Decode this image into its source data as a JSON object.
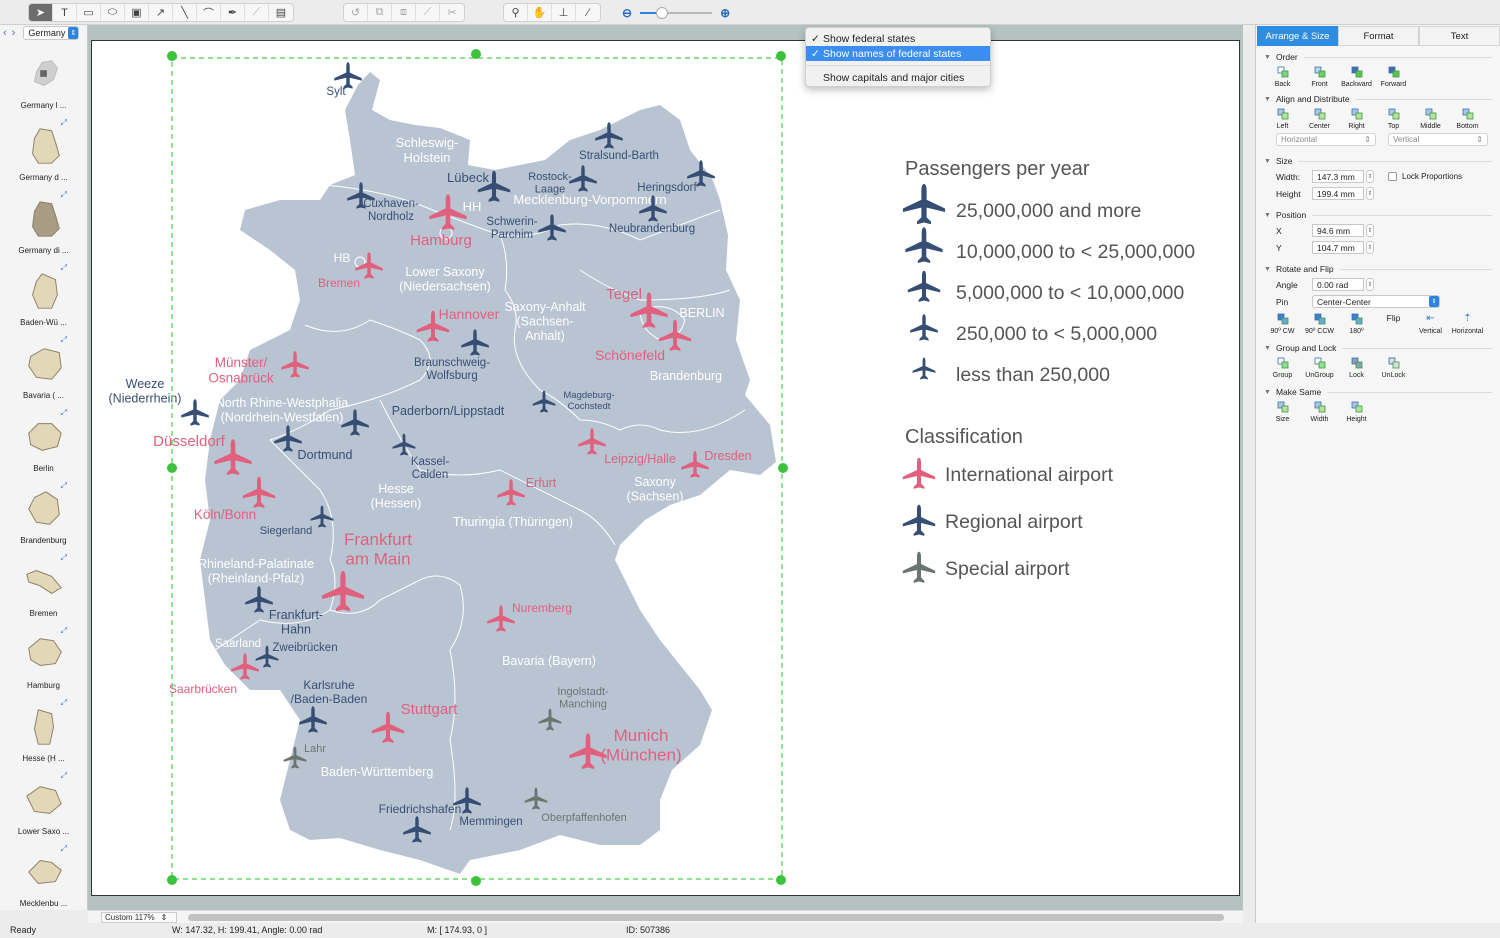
{
  "toolbar": {
    "groups": [
      {
        "icons": [
          "pointer-tool",
          "text-tool",
          "rectangle-tool",
          "ellipse-tool",
          "container-tool",
          "arrow-tool",
          "line-tool",
          "arc-tool",
          "pen-tool",
          "bezier-tool",
          "note-tool"
        ]
      },
      {
        "icons": [
          "rotate",
          "group-align",
          "ungroup-align",
          "connect",
          "disconnect"
        ]
      },
      {
        "icons": [
          "zoom-tool",
          "hand-tool",
          "stamp-tool",
          "eyedropper-tool"
        ]
      }
    ],
    "zoom_slider_percent": 30
  },
  "library": {
    "selected": "Germany",
    "items": [
      {
        "label": "Germany l ..."
      },
      {
        "label": "Germany d ..."
      },
      {
        "label": "Germany di ..."
      },
      {
        "label": "Baden-Wü ..."
      },
      {
        "label": "Bavaria ( ..."
      },
      {
        "label": "Berlin"
      },
      {
        "label": "Brandenburg"
      },
      {
        "label": "Bremen"
      },
      {
        "label": "Hamburg"
      },
      {
        "label": "Hesse (H ..."
      },
      {
        "label": "Lower Saxo ..."
      },
      {
        "label": "Mecklenbu ..."
      }
    ]
  },
  "context_menu": {
    "items": [
      {
        "label": "Show federal states",
        "checked": true,
        "highlighted": false
      },
      {
        "label": "Show names of federal states",
        "checked": true,
        "highlighted": true
      },
      {
        "label": "Show capitals and major cities",
        "checked": false,
        "highlighted": false
      }
    ]
  },
  "map": {
    "colors": {
      "land": "#b9c4d2",
      "international": "#e0607e",
      "regional": "#374e74",
      "special": "#6a7570",
      "state_label": "#ffffff"
    },
    "states": [
      {
        "name": "Schleswig-\nHolstein"
      },
      {
        "name": "HH"
      },
      {
        "name": "Mecklenburg-Vorpommern"
      },
      {
        "name": "HB"
      },
      {
        "name": "Lower Saxony\n(Niedersachsen)"
      },
      {
        "name": "Saxony-Anhalt\n(Sachsen-\nAnhalt)"
      },
      {
        "name": "BERLIN"
      },
      {
        "name": "Brandenburg"
      },
      {
        "name": "North Rhine-Westphalia\n(Nordrhein-Westfalen)"
      },
      {
        "name": "Hesse\n(Hessen)"
      },
      {
        "name": "Thuringia (Thüringen)"
      },
      {
        "name": "Saxony\n(Sachsen)"
      },
      {
        "name": "Rhineland-Palatinate\n(Rheinland-Pfalz)"
      },
      {
        "name": "Saarland"
      },
      {
        "name": "Bavaria (Bayern)"
      },
      {
        "name": "Baden-Württemberg"
      }
    ],
    "airports": [
      {
        "name": "Sylt",
        "class": "regional",
        "size": 4
      },
      {
        "name": "Lübeck",
        "class": "regional",
        "size": 3
      },
      {
        "name": "Cuxhaven-\nNordholz",
        "class": "regional",
        "size": 4
      },
      {
        "name": "Hamburg",
        "class": "international",
        "size": 2
      },
      {
        "name": "Rostock-\nLaage",
        "class": "regional",
        "size": 4
      },
      {
        "name": "Stralsund-Barth",
        "class": "regional",
        "size": 4
      },
      {
        "name": "Heringsdorf",
        "class": "regional",
        "size": 4
      },
      {
        "name": "Schwerin-\nParchim",
        "class": "regional",
        "size": 4
      },
      {
        "name": "Neubrandenburg",
        "class": "regional",
        "size": 4
      },
      {
        "name": "Bremen",
        "class": "international",
        "size": 4
      },
      {
        "name": "Hannover",
        "class": "international",
        "size": 3
      },
      {
        "name": "Braunschweig-\nWolfsburg",
        "class": "regional",
        "size": 4
      },
      {
        "name": "Tegel",
        "class": "international",
        "size": 2
      },
      {
        "name": "Schönefeld",
        "class": "international",
        "size": 3
      },
      {
        "name": "Münster/\nOsnabrück",
        "class": "international",
        "size": 4
      },
      {
        "name": "Weeze\n(Niederrhein)",
        "class": "regional",
        "size": 4
      },
      {
        "name": "Paderborn/Lippstadt",
        "class": "regional",
        "size": 4
      },
      {
        "name": "Dortmund",
        "class": "regional",
        "size": 4
      },
      {
        "name": "Magdeburg-\nCochstedt",
        "class": "regional",
        "size": 5
      },
      {
        "name": "Düsseldorf",
        "class": "international",
        "size": 2
      },
      {
        "name": "Kassel-\nCalden",
        "class": "regional",
        "size": 5
      },
      {
        "name": "Leipzig/Halle",
        "class": "international",
        "size": 4
      },
      {
        "name": "Dresden",
        "class": "international",
        "size": 4
      },
      {
        "name": "Erfurt",
        "class": "international",
        "size": 4
      },
      {
        "name": "Köln/Bonn",
        "class": "international",
        "size": 3
      },
      {
        "name": "Siegerland",
        "class": "regional",
        "size": 5
      },
      {
        "name": "Frankfurt\nam Main",
        "class": "international",
        "size": 1
      },
      {
        "name": "Frankfurt-\nHahn",
        "class": "regional",
        "size": 4
      },
      {
        "name": "Nuremberg",
        "class": "international",
        "size": 4
      },
      {
        "name": "Saarbrücken",
        "class": "international",
        "size": 4
      },
      {
        "name": "Zweibrücken",
        "class": "regional",
        "size": 5
      },
      {
        "name": "Karlsruhe\n/Baden-Baden",
        "class": "regional",
        "size": 4
      },
      {
        "name": "Stuttgart",
        "class": "international",
        "size": 3
      },
      {
        "name": "Ingolstadt-\nManching",
        "class": "special",
        "size": 5
      },
      {
        "name": "Munich\n(München)",
        "class": "international",
        "size": 2
      },
      {
        "name": "Lahr",
        "class": "special",
        "size": 5
      },
      {
        "name": "Friedrichshafen",
        "class": "regional",
        "size": 4
      },
      {
        "name": "Memmingen",
        "class": "regional",
        "size": 4
      },
      {
        "name": "Oberpfaffenhofen",
        "class": "special",
        "size": 5
      }
    ]
  },
  "legend": {
    "passengers_title": "Passengers per year",
    "passengers": [
      {
        "label": "25,000,000 and more"
      },
      {
        "label": "10,000,000 to < 25,000,000"
      },
      {
        "label": "5,000,000 to < 10,000,000"
      },
      {
        "label": "250,000 to < 5,000,000"
      },
      {
        "label": "less than 250,000"
      }
    ],
    "classification_title": "Classification",
    "classification": [
      {
        "label": "International airport",
        "color": "#e0607e"
      },
      {
        "label": "Regional airport",
        "color": "#374e74"
      },
      {
        "label": "Special airport",
        "color": "#6a7570"
      }
    ]
  },
  "canvas": {
    "zoom_label": "Custom 117%"
  },
  "status": {
    "ready": "Ready",
    "dims": "W: 147.32,  H: 199.41,  Angle: 0.00 rad",
    "mouse": "M: [ 174.93, 0 ]",
    "id": "ID: 507386"
  },
  "inspector": {
    "tabs": [
      "Arrange & Size",
      "Format",
      "Text"
    ],
    "order": {
      "title": "Order",
      "buttons": [
        "Back",
        "Front",
        "Backward",
        "Forward"
      ]
    },
    "align": {
      "title": "Align and Distribute",
      "buttons": [
        "Left",
        "Center",
        "Right",
        "Top",
        "Middle",
        "Bottom"
      ],
      "horizontal": "Horizontal",
      "vertical": "Vertical"
    },
    "size": {
      "title": "Size",
      "width_label": "Width:",
      "width": "147.3 mm",
      "height_label": "Height",
      "height": "199.4 mm",
      "lock": "Lock Proportions"
    },
    "position": {
      "title": "Position",
      "x_label": "X",
      "x": "94.6 mm",
      "y_label": "Y",
      "y": "104.7 mm"
    },
    "rotate": {
      "title": "Rotate and Flip",
      "angle_label": "Angle",
      "angle": "0.00 rad",
      "pin_label": "Pin",
      "pin": "Center-Center",
      "buttons": [
        "90º CW",
        "90º CCW",
        "180º"
      ],
      "flip_label": "Flip",
      "flip_buttons": [
        "Vertical",
        "Horizontal"
      ]
    },
    "group": {
      "title": "Group and Lock",
      "buttons": [
        "Group",
        "UnGroup",
        "Lock",
        "UnLock"
      ]
    },
    "same": {
      "title": "Make Same",
      "buttons": [
        "Size",
        "Width",
        "Height"
      ]
    }
  }
}
